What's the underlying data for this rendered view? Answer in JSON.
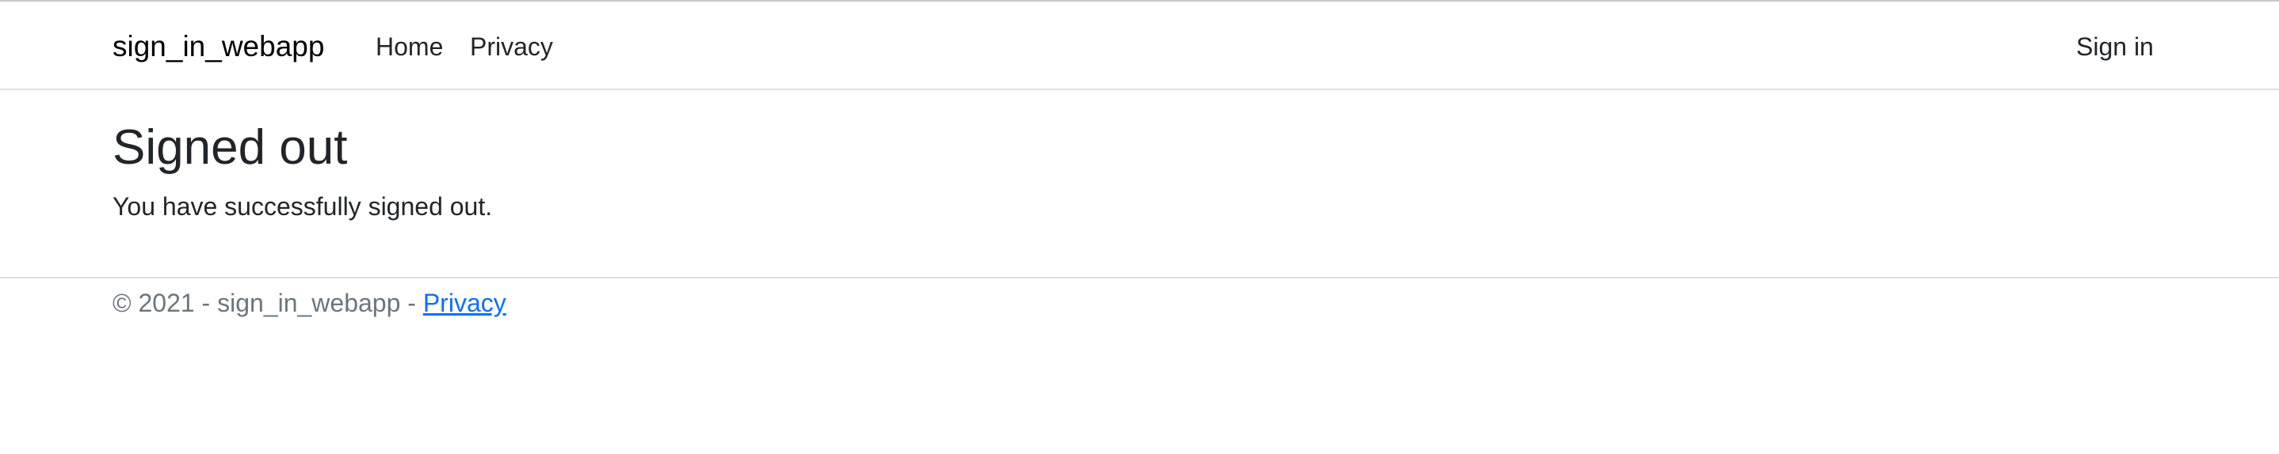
{
  "navbar": {
    "brand": "sign_in_webapp",
    "links": [
      {
        "label": "Home"
      },
      {
        "label": "Privacy"
      }
    ],
    "signin_label": "Sign in"
  },
  "main": {
    "title": "Signed out",
    "message": "You have successfully signed out."
  },
  "footer": {
    "copyright_prefix": "© 2021 - sign_in_webapp - ",
    "privacy_link": "Privacy"
  },
  "colors": {
    "text": "#212529",
    "muted": "#6c757d",
    "link": "#0d6efd",
    "border": "#dee2e6"
  }
}
